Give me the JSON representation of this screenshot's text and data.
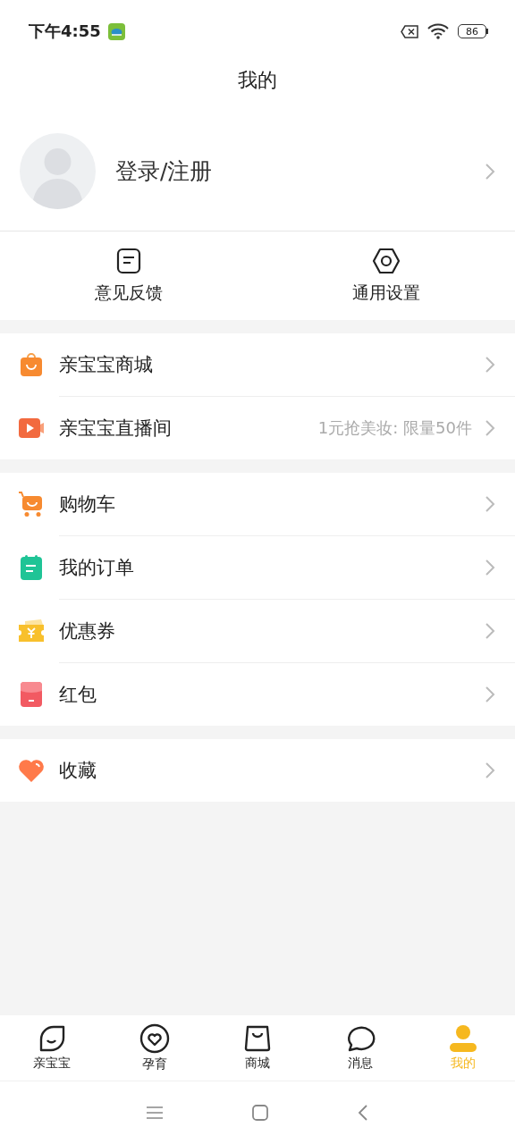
{
  "status_bar": {
    "time": "下午4:55",
    "battery": "86"
  },
  "title": "我的",
  "profile": {
    "label": "登录/注册"
  },
  "quick_actions": [
    {
      "kind": "feedback",
      "label": "意见反馈"
    },
    {
      "kind": "settings",
      "label": "通用设置"
    }
  ],
  "menu_groups": [
    {
      "items": [
        {
          "kind": "mall",
          "label": "亲宝宝商城"
        },
        {
          "kind": "live",
          "label": "亲宝宝直播间",
          "note": "1元抢美妆: 限量50件"
        }
      ]
    },
    {
      "items": [
        {
          "kind": "cart",
          "label": "购物车"
        },
        {
          "kind": "orders",
          "label": "我的订单"
        },
        {
          "kind": "coupon",
          "label": "优惠券"
        },
        {
          "kind": "redpacket",
          "label": "红包"
        }
      ]
    },
    {
      "items": [
        {
          "kind": "favorite",
          "label": "收藏"
        }
      ]
    }
  ],
  "tabs": [
    {
      "kind": "home",
      "label": "亲宝宝",
      "selected": false
    },
    {
      "kind": "parenting",
      "label": "孕育",
      "selected": false
    },
    {
      "kind": "mall",
      "label": "商城",
      "selected": false
    },
    {
      "kind": "messages",
      "label": "消息",
      "selected": false
    },
    {
      "kind": "me",
      "label": "我的",
      "selected": true
    }
  ]
}
